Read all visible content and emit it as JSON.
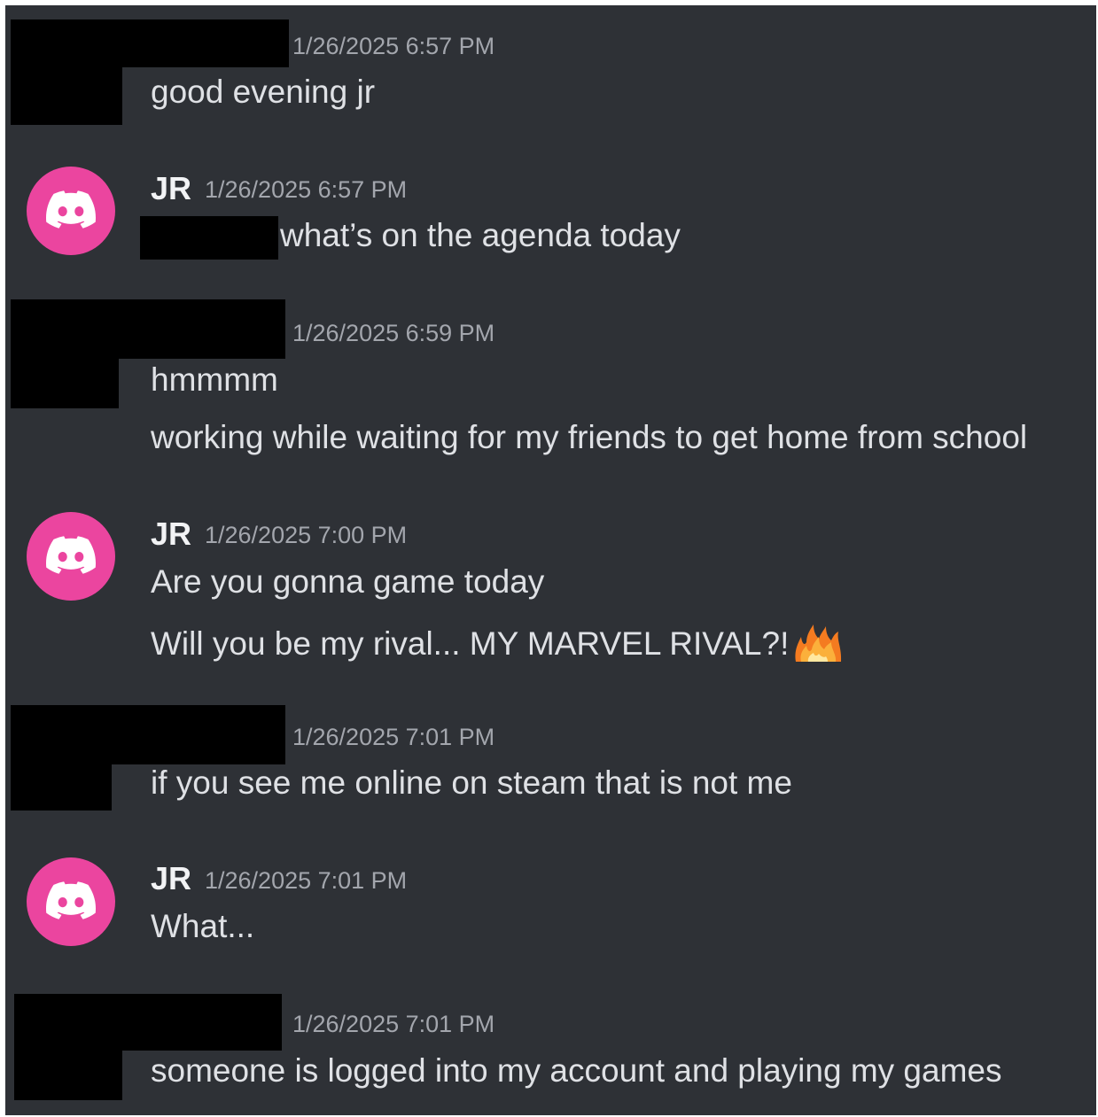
{
  "colors": {
    "background": "#2e3136",
    "avatar": "#eb459f",
    "timestamp": "#a3a6ad",
    "message_text": "#dfe1e5",
    "author_name": "#f2f3f5",
    "redaction": "#000000"
  },
  "messages": [
    {
      "author": "",
      "redacted_author": true,
      "timestamp": "1/26/2025 6:57 PM",
      "lines": [
        "good evening jr"
      ]
    },
    {
      "author": "JR",
      "avatar_icon": "discord-logo-icon",
      "timestamp": "1/26/2025 6:57 PM",
      "lines": [
        "what’s on the agenda today"
      ],
      "redacted_prefix": true
    },
    {
      "author": "",
      "redacted_author": true,
      "timestamp": "1/26/2025 6:59 PM",
      "lines": [
        "hmmmm",
        "working while waiting for my friends to get home from school"
      ]
    },
    {
      "author": "JR",
      "avatar_icon": "discord-logo-icon",
      "timestamp": "1/26/2025 7:00 PM",
      "lines": [
        "Are you gonna game today",
        "Will you be my rival... MY MARVEL RIVAL?!"
      ],
      "emoji": "fire-emoji-icon"
    },
    {
      "author": "",
      "redacted_author": true,
      "timestamp": "1/26/2025 7:01 PM",
      "lines": [
        "if you see me online on steam that is not me"
      ]
    },
    {
      "author": "JR",
      "avatar_icon": "discord-logo-icon",
      "timestamp": "1/26/2025 7:01 PM",
      "lines": [
        "What..."
      ]
    },
    {
      "author": "",
      "redacted_author": true,
      "timestamp": "1/26/2025 7:01 PM",
      "lines": [
        "someone is logged into my account and playing my games"
      ]
    }
  ]
}
